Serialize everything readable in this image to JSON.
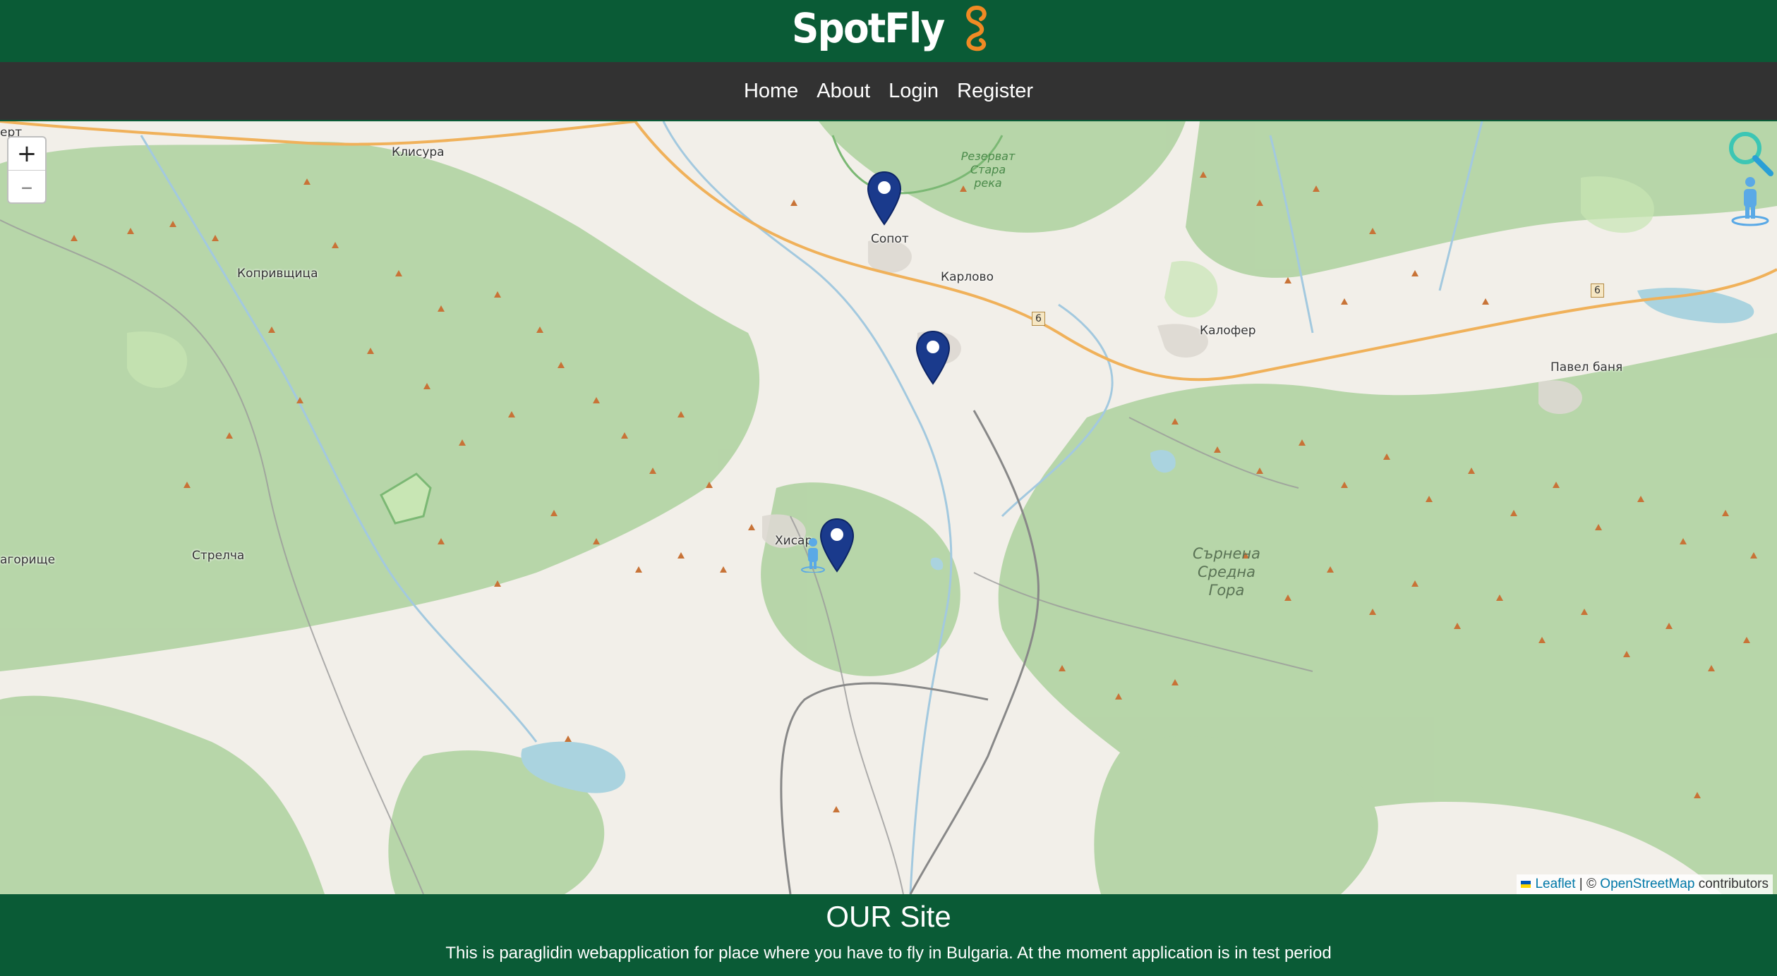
{
  "brand": {
    "name": "SpotFly",
    "color": "#0a5b36",
    "accent": "#f08a24"
  },
  "nav": [
    {
      "label": "Home"
    },
    {
      "label": "About"
    },
    {
      "label": "Login"
    },
    {
      "label": "Register"
    }
  ],
  "map": {
    "zoom_in": "+",
    "zoom_out": "–",
    "attribution": {
      "leaflet": "Leaflet",
      "separator": "| ©",
      "osm": "OpenStreetMap",
      "suffix": "contributors"
    },
    "places": {
      "klisura": "Клисура",
      "koprivshtitsa": "Копривщица",
      "sopot": "Сопот",
      "karlovo": "Карлово",
      "kalofer": "Калофер",
      "pavel_banya": "Павел баня",
      "strelcha": "Стрелча",
      "hisarya": "Хисар",
      "agorishte": "агорище",
      "top_left": "ерт"
    },
    "forest": [
      "Сърнена",
      "Средна",
      "Гора"
    ],
    "reserve": [
      "Резерват",
      "Стара",
      "река"
    ],
    "road_number": "6",
    "markers": [
      {
        "place": "Сопот"
      },
      {
        "place": "Карлово"
      },
      {
        "place": "Хисар"
      }
    ],
    "icons": [
      "search-icon",
      "locate-person-icon",
      "map-marker-icon",
      "paraglider-person-icon"
    ]
  },
  "footer": {
    "heading": "OUR Site",
    "text": "This is paraglidin webapplication for place where you have to fly in Bulgaria. At the moment application is in test period"
  }
}
